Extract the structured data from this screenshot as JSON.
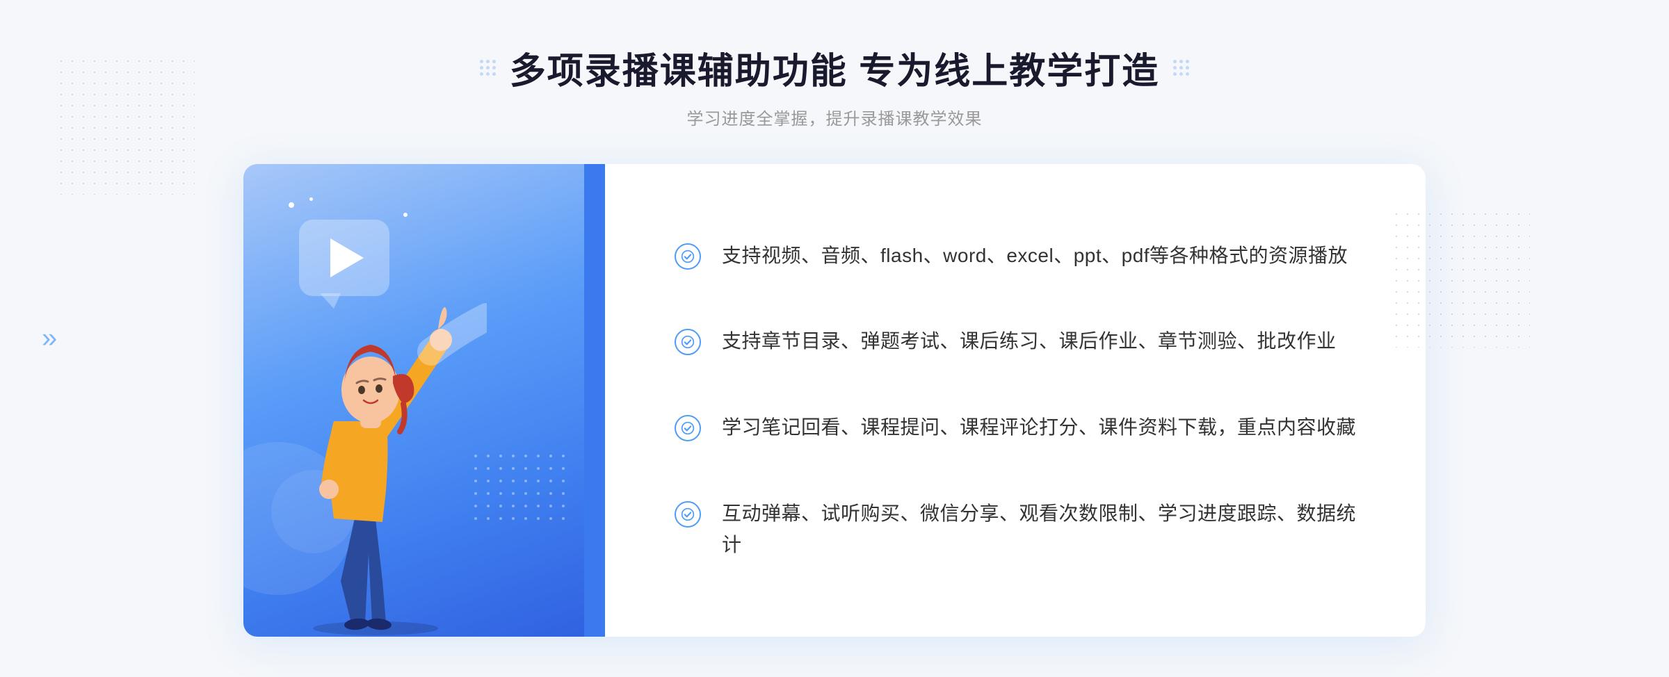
{
  "header": {
    "title": "多项录播课辅助功能 专为线上教学打造",
    "subtitle": "学习进度全掌握，提升录播课教学效果"
  },
  "features": [
    {
      "id": 1,
      "text": "支持视频、音频、flash、word、excel、ppt、pdf等各种格式的资源播放"
    },
    {
      "id": 2,
      "text": "支持章节目录、弹题考试、课后练习、课后作业、章节测验、批改作业"
    },
    {
      "id": 3,
      "text": "学习笔记回看、课程提问、课程评论打分、课件资料下载，重点内容收藏"
    },
    {
      "id": 4,
      "text": "互动弹幕、试听购买、微信分享、观看次数限制、学习进度跟踪、数据统计"
    }
  ],
  "decorators": {
    "chevron_left": "»",
    "check_color": "#4d9cf8",
    "title_color": "#1a1a2e",
    "subtitle_color": "#999999"
  }
}
